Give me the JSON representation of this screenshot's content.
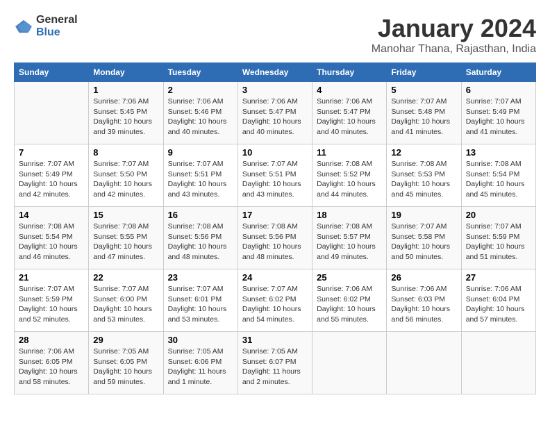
{
  "app": {
    "logo_general": "General",
    "logo_blue": "Blue"
  },
  "title": "January 2024",
  "location": "Manohar Thana, Rajasthan, India",
  "days_of_week": [
    "Sunday",
    "Monday",
    "Tuesday",
    "Wednesday",
    "Thursday",
    "Friday",
    "Saturday"
  ],
  "weeks": [
    [
      {
        "day": "",
        "content": ""
      },
      {
        "day": "1",
        "content": "Sunrise: 7:06 AM\nSunset: 5:45 PM\nDaylight: 10 hours\nand 39 minutes."
      },
      {
        "day": "2",
        "content": "Sunrise: 7:06 AM\nSunset: 5:46 PM\nDaylight: 10 hours\nand 40 minutes."
      },
      {
        "day": "3",
        "content": "Sunrise: 7:06 AM\nSunset: 5:47 PM\nDaylight: 10 hours\nand 40 minutes."
      },
      {
        "day": "4",
        "content": "Sunrise: 7:06 AM\nSunset: 5:47 PM\nDaylight: 10 hours\nand 40 minutes."
      },
      {
        "day": "5",
        "content": "Sunrise: 7:07 AM\nSunset: 5:48 PM\nDaylight: 10 hours\nand 41 minutes."
      },
      {
        "day": "6",
        "content": "Sunrise: 7:07 AM\nSunset: 5:49 PM\nDaylight: 10 hours\nand 41 minutes."
      }
    ],
    [
      {
        "day": "7",
        "content": "Sunrise: 7:07 AM\nSunset: 5:49 PM\nDaylight: 10 hours\nand 42 minutes."
      },
      {
        "day": "8",
        "content": "Sunrise: 7:07 AM\nSunset: 5:50 PM\nDaylight: 10 hours\nand 42 minutes."
      },
      {
        "day": "9",
        "content": "Sunrise: 7:07 AM\nSunset: 5:51 PM\nDaylight: 10 hours\nand 43 minutes."
      },
      {
        "day": "10",
        "content": "Sunrise: 7:07 AM\nSunset: 5:51 PM\nDaylight: 10 hours\nand 43 minutes."
      },
      {
        "day": "11",
        "content": "Sunrise: 7:08 AM\nSunset: 5:52 PM\nDaylight: 10 hours\nand 44 minutes."
      },
      {
        "day": "12",
        "content": "Sunrise: 7:08 AM\nSunset: 5:53 PM\nDaylight: 10 hours\nand 45 minutes."
      },
      {
        "day": "13",
        "content": "Sunrise: 7:08 AM\nSunset: 5:54 PM\nDaylight: 10 hours\nand 45 minutes."
      }
    ],
    [
      {
        "day": "14",
        "content": "Sunrise: 7:08 AM\nSunset: 5:54 PM\nDaylight: 10 hours\nand 46 minutes."
      },
      {
        "day": "15",
        "content": "Sunrise: 7:08 AM\nSunset: 5:55 PM\nDaylight: 10 hours\nand 47 minutes."
      },
      {
        "day": "16",
        "content": "Sunrise: 7:08 AM\nSunset: 5:56 PM\nDaylight: 10 hours\nand 48 minutes."
      },
      {
        "day": "17",
        "content": "Sunrise: 7:08 AM\nSunset: 5:56 PM\nDaylight: 10 hours\nand 48 minutes."
      },
      {
        "day": "18",
        "content": "Sunrise: 7:08 AM\nSunset: 5:57 PM\nDaylight: 10 hours\nand 49 minutes."
      },
      {
        "day": "19",
        "content": "Sunrise: 7:07 AM\nSunset: 5:58 PM\nDaylight: 10 hours\nand 50 minutes."
      },
      {
        "day": "20",
        "content": "Sunrise: 7:07 AM\nSunset: 5:59 PM\nDaylight: 10 hours\nand 51 minutes."
      }
    ],
    [
      {
        "day": "21",
        "content": "Sunrise: 7:07 AM\nSunset: 5:59 PM\nDaylight: 10 hours\nand 52 minutes."
      },
      {
        "day": "22",
        "content": "Sunrise: 7:07 AM\nSunset: 6:00 PM\nDaylight: 10 hours\nand 53 minutes."
      },
      {
        "day": "23",
        "content": "Sunrise: 7:07 AM\nSunset: 6:01 PM\nDaylight: 10 hours\nand 53 minutes."
      },
      {
        "day": "24",
        "content": "Sunrise: 7:07 AM\nSunset: 6:02 PM\nDaylight: 10 hours\nand 54 minutes."
      },
      {
        "day": "25",
        "content": "Sunrise: 7:06 AM\nSunset: 6:02 PM\nDaylight: 10 hours\nand 55 minutes."
      },
      {
        "day": "26",
        "content": "Sunrise: 7:06 AM\nSunset: 6:03 PM\nDaylight: 10 hours\nand 56 minutes."
      },
      {
        "day": "27",
        "content": "Sunrise: 7:06 AM\nSunset: 6:04 PM\nDaylight: 10 hours\nand 57 minutes."
      }
    ],
    [
      {
        "day": "28",
        "content": "Sunrise: 7:06 AM\nSunset: 6:05 PM\nDaylight: 10 hours\nand 58 minutes."
      },
      {
        "day": "29",
        "content": "Sunrise: 7:05 AM\nSunset: 6:05 PM\nDaylight: 10 hours\nand 59 minutes."
      },
      {
        "day": "30",
        "content": "Sunrise: 7:05 AM\nSunset: 6:06 PM\nDaylight: 11 hours\nand 1 minute."
      },
      {
        "day": "31",
        "content": "Sunrise: 7:05 AM\nSunset: 6:07 PM\nDaylight: 11 hours\nand 2 minutes."
      },
      {
        "day": "",
        "content": ""
      },
      {
        "day": "",
        "content": ""
      },
      {
        "day": "",
        "content": ""
      }
    ]
  ]
}
